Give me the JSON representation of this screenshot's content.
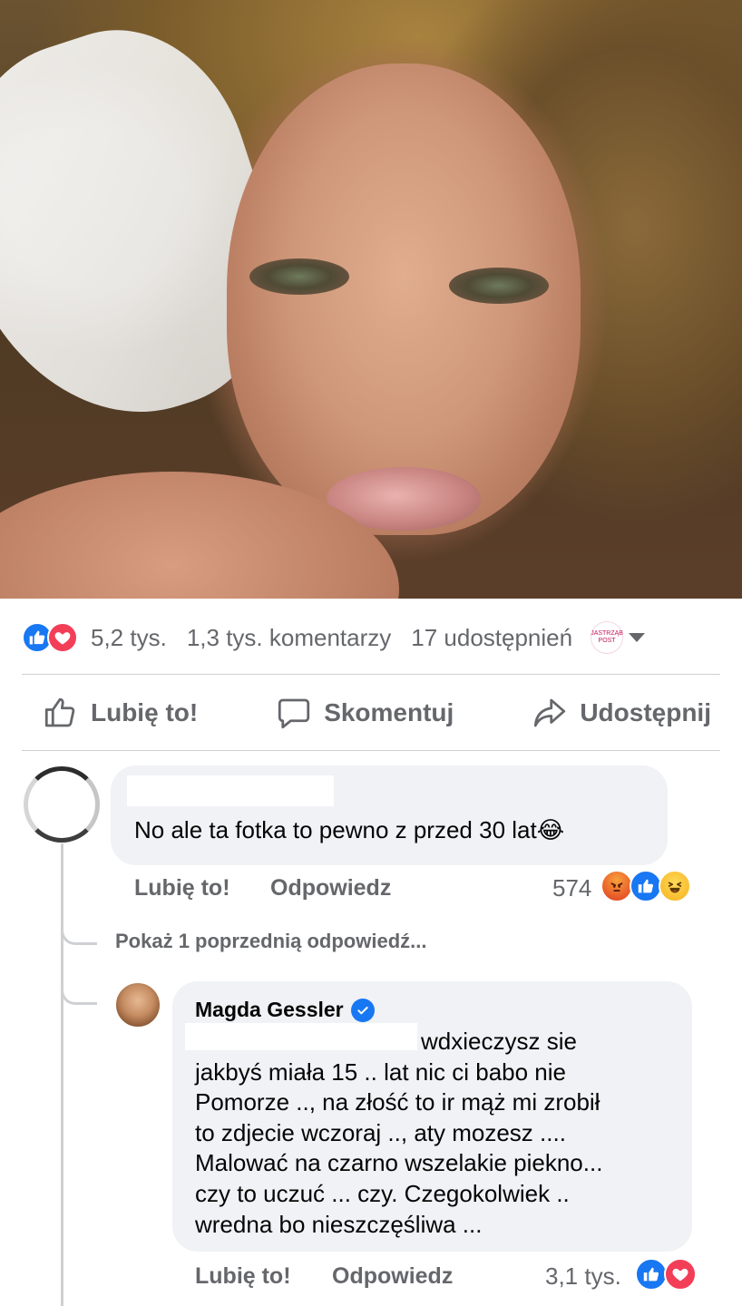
{
  "post": {
    "stats": {
      "reactions": "5,2 tys.",
      "comments": "1,3 tys. komentarzy",
      "shares": "17 udostępnień",
      "page_logo_text": "JASTRZĄB POST"
    },
    "actions": {
      "like": "Lubię to!",
      "comment": "Skomentuj",
      "share": "Udostępnij"
    }
  },
  "comments": [
    {
      "author_hidden": true,
      "text": "No ale ta fotka to pewno z przed 30 lat😂",
      "like_label": "Lubię to!",
      "reply_label": "Odpowiedz",
      "reaction_count": "574",
      "reactions": [
        "angry",
        "like",
        "haha"
      ]
    }
  ],
  "show_previous": "Pokaż 1 poprzednią odpowiedź...",
  "reply": {
    "author": "Magda Gessler",
    "verified": true,
    "text_lines": [
      "wdxieczysz sie",
      "jakbyś miała 15 .. lat nic ci babo nie",
      "Pomorze .., na złość to ir mąż mi zrobił",
      "to zdjecie wczoraj .., aty mozesz ....",
      "Malować na czarno wszelakie piekno...",
      "czy to uczuć ... czy. Czegokolwiek ..",
      "wredna bo nieszczęśliwa ..."
    ],
    "like_label": "Lubię to!",
    "reply_label": "Odpowiedz",
    "reaction_count": "3,1 tys.",
    "reactions": [
      "like",
      "love"
    ]
  },
  "colors": {
    "facebook_blue": "#1877f2",
    "love_red": "#f33e58",
    "secondary_text": "#65676b",
    "bubble_bg": "#f0f2f5"
  }
}
